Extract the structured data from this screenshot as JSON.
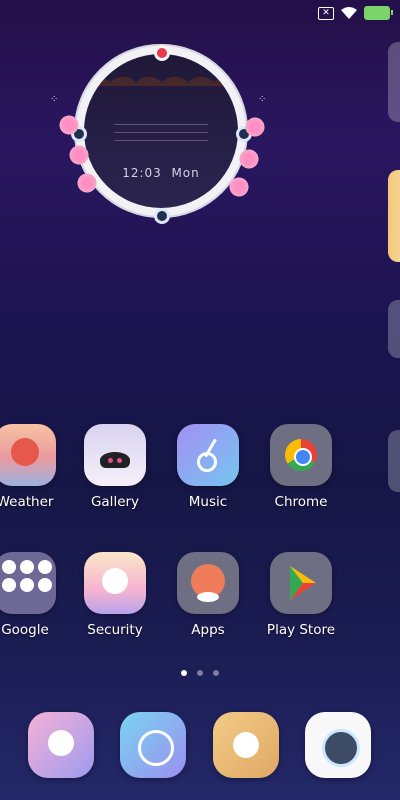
{
  "status_bar": {
    "icons": [
      "close-box-icon",
      "wifi-icon",
      "battery-charging-icon"
    ]
  },
  "clock": {
    "time": "12:03",
    "day": "Mon"
  },
  "apps_row1": [
    {
      "label": "Weather",
      "icon": "weather-icon"
    },
    {
      "label": "Gallery",
      "icon": "gallery-icon"
    },
    {
      "label": "Music",
      "icon": "music-icon"
    },
    {
      "label": "Chrome",
      "icon": "chrome-icon"
    }
  ],
  "apps_row2": [
    {
      "label": "Google",
      "icon": "google-folder-icon"
    },
    {
      "label": "Security",
      "icon": "security-icon"
    },
    {
      "label": "Apps",
      "icon": "apps-icon"
    },
    {
      "label": "Play Store",
      "icon": "play-store-icon"
    }
  ],
  "page_indicator": {
    "pages": 3,
    "active": 0
  },
  "dock": [
    {
      "icon": "phone-icon"
    },
    {
      "icon": "messages-icon"
    },
    {
      "icon": "browser-icon"
    },
    {
      "icon": "camera-icon"
    }
  ]
}
